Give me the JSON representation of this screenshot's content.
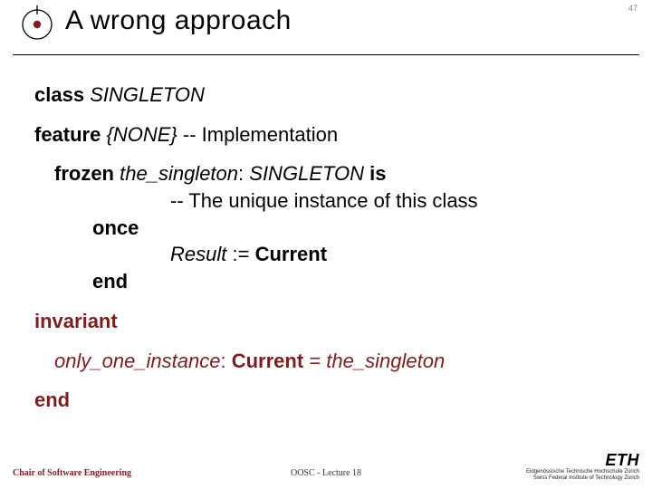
{
  "header": {
    "title": "A wrong approach",
    "page_number": "47"
  },
  "code": {
    "kw_class": "class",
    "cls_name": "SINGLETON",
    "kw_feature": "feature",
    "export_clause": "{NONE}",
    "feature_comment": "-- Implementation",
    "kw_frozen": "frozen",
    "feat_name": "the_singleton",
    "type_colon": ":",
    "ret_type": "SINGLETON",
    "kw_is": "is",
    "routine_comment": "-- The unique instance of this class",
    "kw_once": "once",
    "result_name": "Result",
    "assign": ":=",
    "kw_current": "Current",
    "kw_end_routine": "end",
    "kw_invariant": "invariant",
    "inv_tag": "only_one_instance",
    "inv_tag_colon": ":",
    "inv_current": "Current",
    "inv_eq": "=",
    "inv_rhs": "the_singleton",
    "kw_end_class": "end"
  },
  "footer": {
    "left": "Chair of Software Engineering",
    "center": "OOSC - Lecture 18",
    "eth": "ETH",
    "ethsub1": "Eidgenössische Technische Hochschule Zürich",
    "ethsub2": "Swiss Federal Institute of Technology Zurich"
  }
}
